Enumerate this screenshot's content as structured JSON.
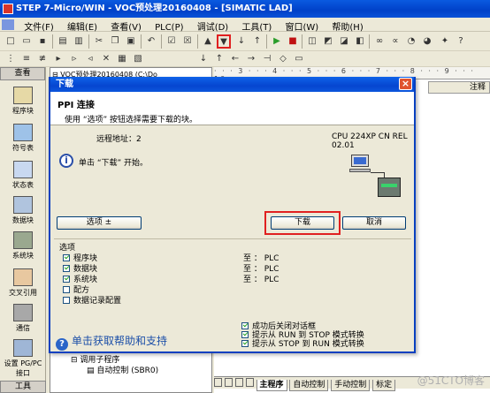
{
  "app": {
    "title": "STEP 7-Micro/WIN - VOC预处理20160408 - [SIMATIC LAD]"
  },
  "menu": [
    "文件(F)",
    "编辑(E)",
    "查看(V)",
    "PLC(P)",
    "调试(D)",
    "工具(T)",
    "窗口(W)",
    "帮助(H)"
  ],
  "navbar": {
    "header": "查看",
    "items": [
      "程序块",
      "符号表",
      "状态表",
      "数据块",
      "系统块",
      "交叉引用",
      "通信",
      "设置 PG/PC 接口"
    ],
    "footer": "工具"
  },
  "tree": {
    "top": "VOC预处理20160408 (C:\\Do",
    "bottom_1": "调用子程序",
    "bottom_2": "自动控制 (SBR0)"
  },
  "editor": {
    "note_header": "注释"
  },
  "tabs": [
    "主程序",
    "自动控制",
    "手动控制",
    "标定"
  ],
  "dialog": {
    "title": "下载",
    "header_title": "PPI 连接",
    "header_sub": "使用 “选项” 按钮选择需要下载的块。",
    "remote_label": "远程地址：2",
    "cpu_info": "CPU 224XP CN REL 02.01",
    "message": "单击 “下载” 开始。",
    "options_button": "选项 ±",
    "download_button": "下载",
    "cancel_button": "取消",
    "options_label": "选项",
    "blocks": [
      {
        "label": "程序块",
        "checked": true,
        "target": "至 ： PLC"
      },
      {
        "label": "数据块",
        "checked": true,
        "target": "至 ： PLC"
      },
      {
        "label": "系统块",
        "checked": true,
        "target": "至 ： PLC"
      },
      {
        "label": "配方",
        "checked": false,
        "target": ""
      },
      {
        "label": "数据记录配置",
        "checked": false,
        "target": ""
      }
    ],
    "after_options": [
      {
        "label": "成功后关闭对话框",
        "checked": true
      },
      {
        "label": "提示从 RUN 到 STOP 模式转换",
        "checked": true
      },
      {
        "label": "提示从 STOP 到 RUN 模式转换",
        "checked": true
      }
    ],
    "help_text": "单击获取帮助和支持"
  },
  "watermark": "@51CTO博客"
}
